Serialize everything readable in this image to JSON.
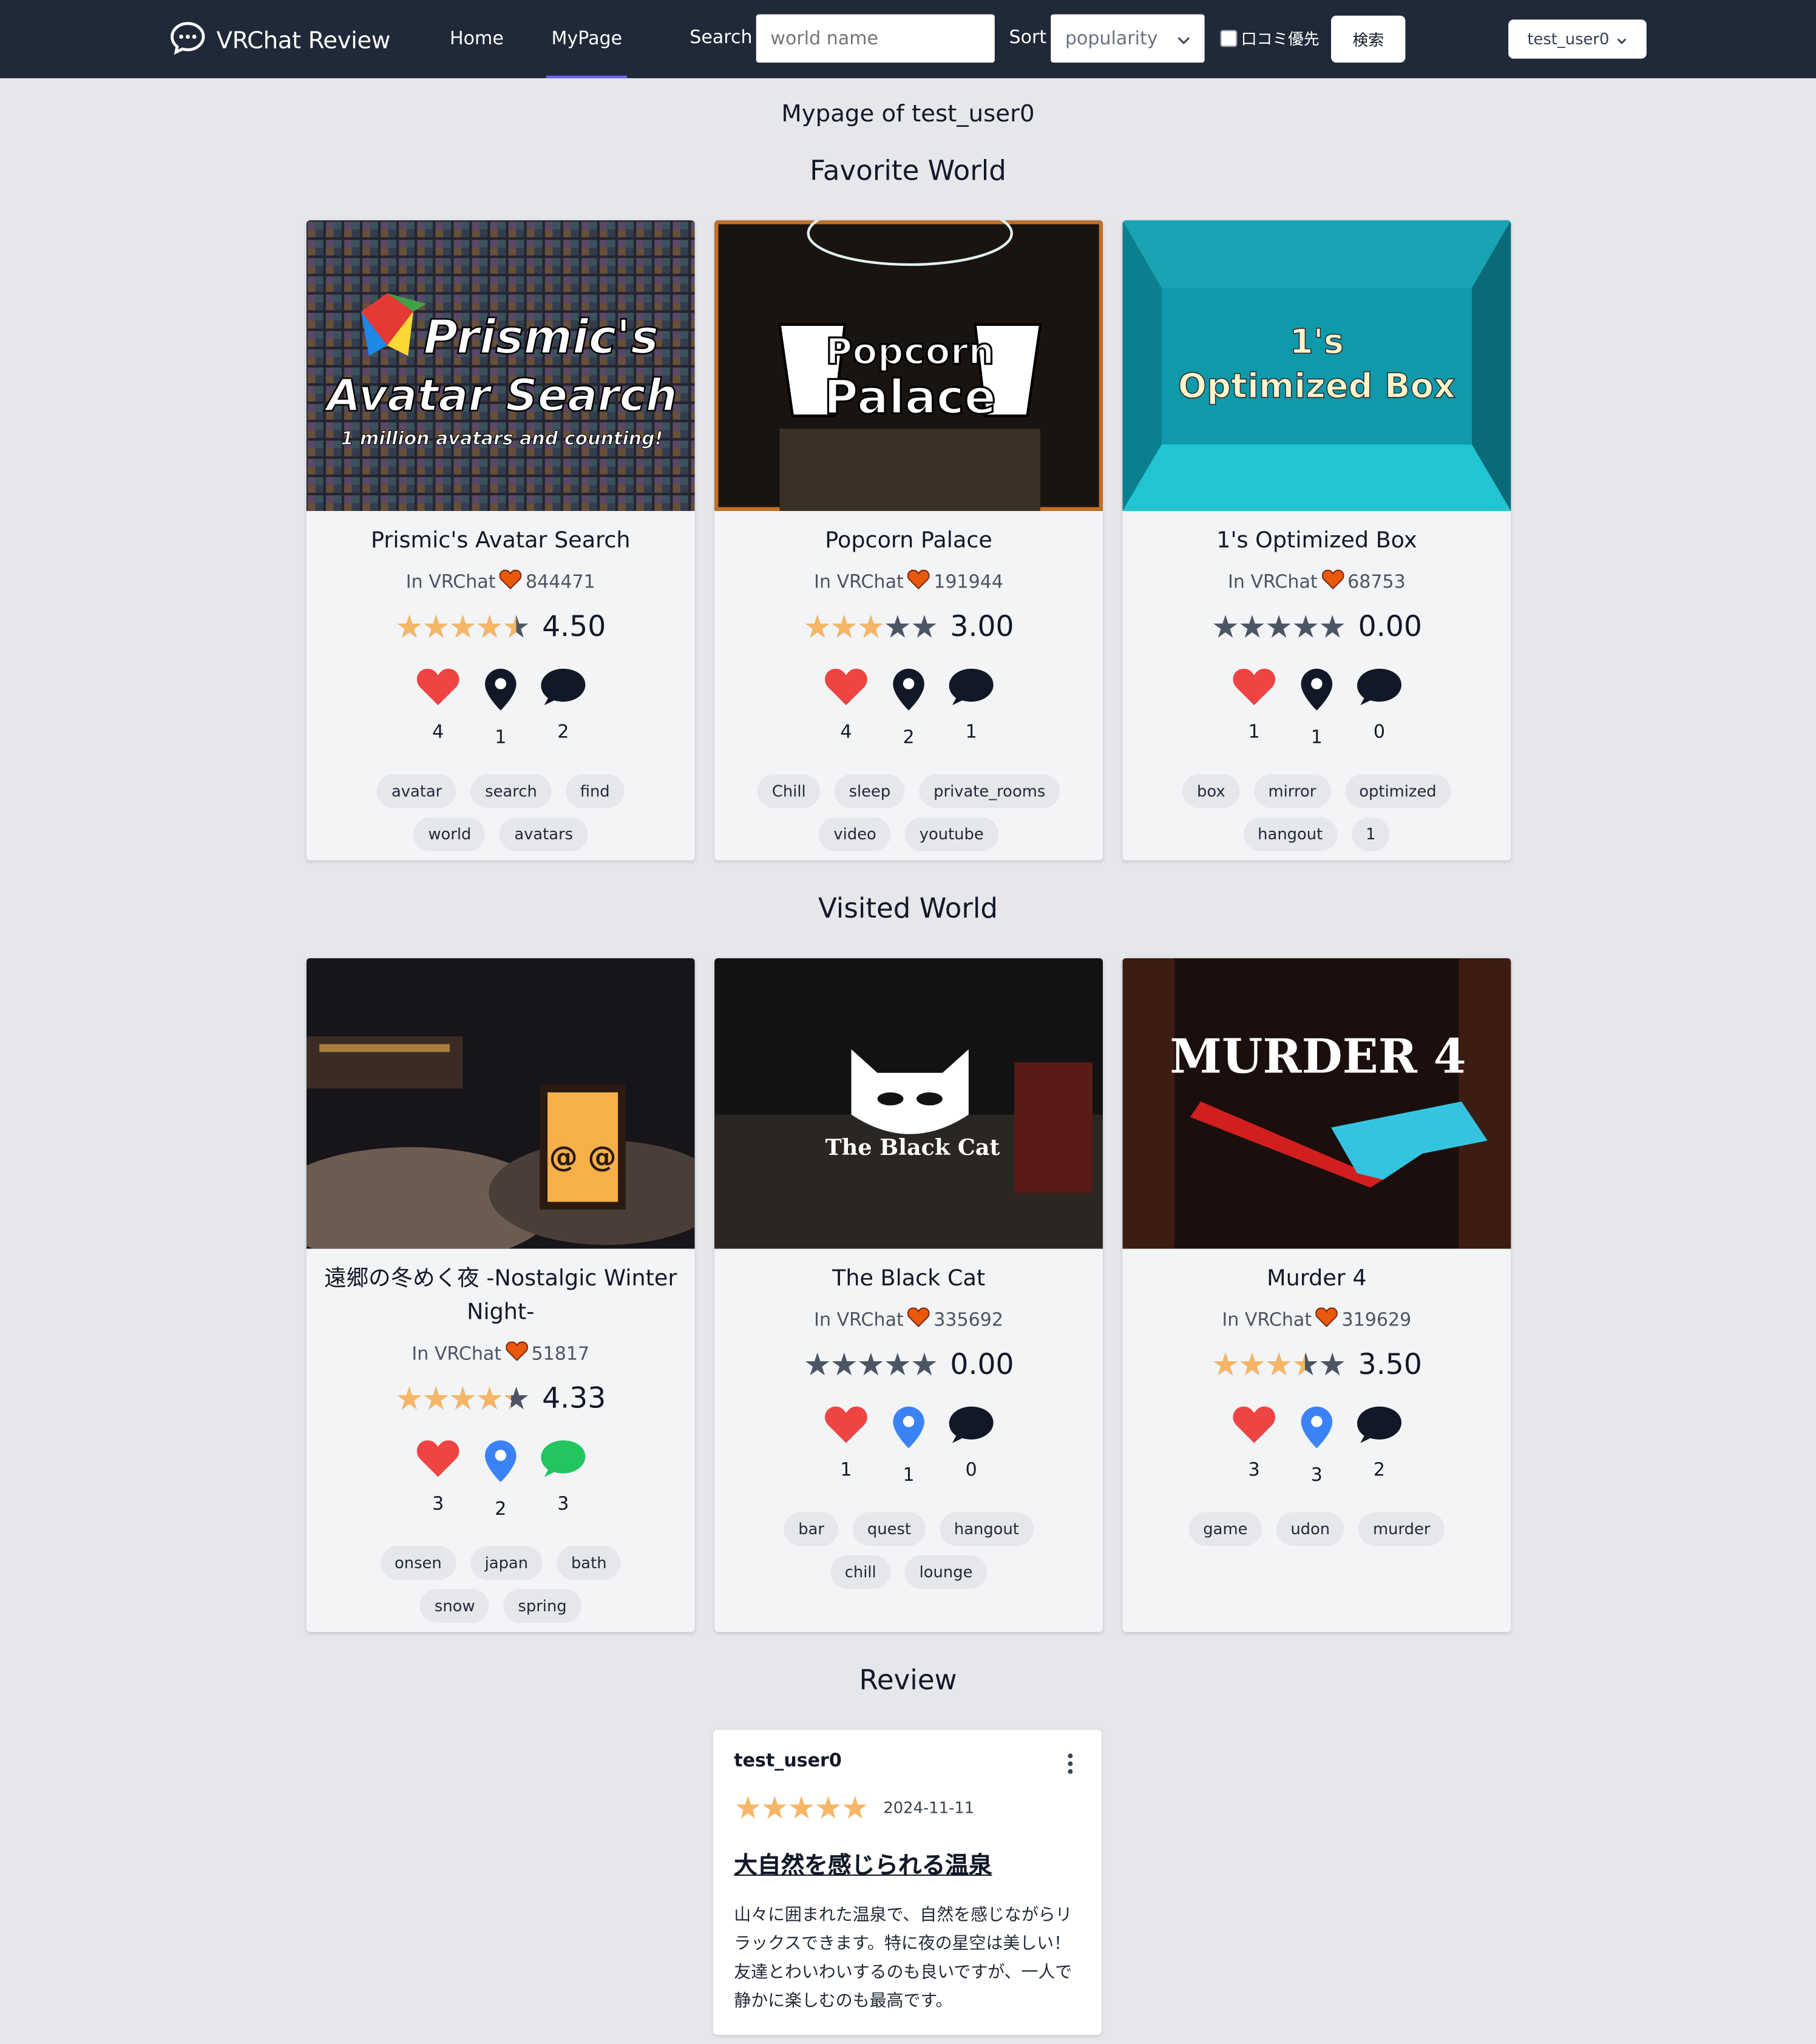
{
  "nav": {
    "brand": "VRChat Review",
    "home": "Home",
    "mypage": "MyPage",
    "search_label": "Search",
    "search_placeholder": "world name",
    "sort_label": "Sort",
    "sort_value": "popularity",
    "review_priority_label": "口コミ優先",
    "search_button": "検索",
    "user": "test_user0"
  },
  "page_subtitle": "Mypage of test_user0",
  "sections": {
    "favorite": "Favorite World",
    "visited": "Visited World",
    "review": "Review"
  },
  "favorite_worlds": [
    {
      "title": "Prismic's Avatar Search",
      "platform": "In VRChat",
      "vrchat_favorites": "844471",
      "rating": 4.5,
      "rating_text": "4.50",
      "likes": "4",
      "visits": "1",
      "comments": "2",
      "tags": [
        "avatar",
        "search",
        "find",
        "world",
        "avatars"
      ],
      "thumb_lines": [
        "Prismic's",
        "Avatar Search",
        "1 million avatars and counting!"
      ]
    },
    {
      "title": "Popcorn Palace",
      "platform": "In VRChat",
      "vrchat_favorites": "191944",
      "rating": 3.0,
      "rating_text": "3.00",
      "likes": "4",
      "visits": "2",
      "comments": "1",
      "tags": [
        "Chill",
        "sleep",
        "private_rooms",
        "video",
        "youtube"
      ],
      "thumb_lines": [
        "Popcorn",
        "Palace"
      ]
    },
    {
      "title": "1's Optimized Box",
      "platform": "In VRChat",
      "vrchat_favorites": "68753",
      "rating": 0,
      "rating_text": "0.00",
      "likes": "1",
      "visits": "1",
      "comments": "0",
      "tags": [
        "box",
        "mirror",
        "optimized",
        "hangout",
        "1"
      ],
      "thumb_lines": [
        "1's",
        "Optimized Box"
      ]
    }
  ],
  "visited_worlds": [
    {
      "title": "遠郷の冬めく夜 -Nostalgic Winter Night-",
      "platform": "In VRChat",
      "vrchat_favorites": "51817",
      "rating": 4.33,
      "rating_text": "4.33",
      "likes": "3",
      "visits": "2",
      "comments": "3",
      "tags": [
        "onsen",
        "japan",
        "bath",
        "snow",
        "spring"
      ]
    },
    {
      "title": "The Black Cat",
      "platform": "In VRChat",
      "vrchat_favorites": "335692",
      "rating": 0,
      "rating_text": "0.00",
      "likes": "1",
      "visits": "1",
      "comments": "0",
      "tags": [
        "bar",
        "quest",
        "hangout",
        "chill",
        "lounge"
      ],
      "thumb_lines": [
        "The Black Cat"
      ]
    },
    {
      "title": "Murder 4",
      "platform": "In VRChat",
      "vrchat_favorites": "319629",
      "rating": 3.5,
      "rating_text": "3.50",
      "likes": "3",
      "visits": "3",
      "comments": "2",
      "tags": [
        "game",
        "udon",
        "murder"
      ],
      "thumb_lines": [
        "MURDER 4"
      ]
    }
  ],
  "review": {
    "user": "test_user0",
    "rating": 5,
    "date": "2024-11-11",
    "title": "大自然を感じられる温泉",
    "body": "山々に囲まれた温泉で、自然を感じながらリラックスできます。特に夜の星空は美しい！友達とわいわいするのも良いですが、一人で静かに楽しむのも最高です。"
  },
  "colors": {
    "nav_bg": "#1f2937",
    "page_bg": "#e5e7eb",
    "star": "#f6b665",
    "heart": "#ef4444",
    "pin_visited": "#3b82f6",
    "comment_active": "#22c55e",
    "accent": "#6366f1"
  }
}
